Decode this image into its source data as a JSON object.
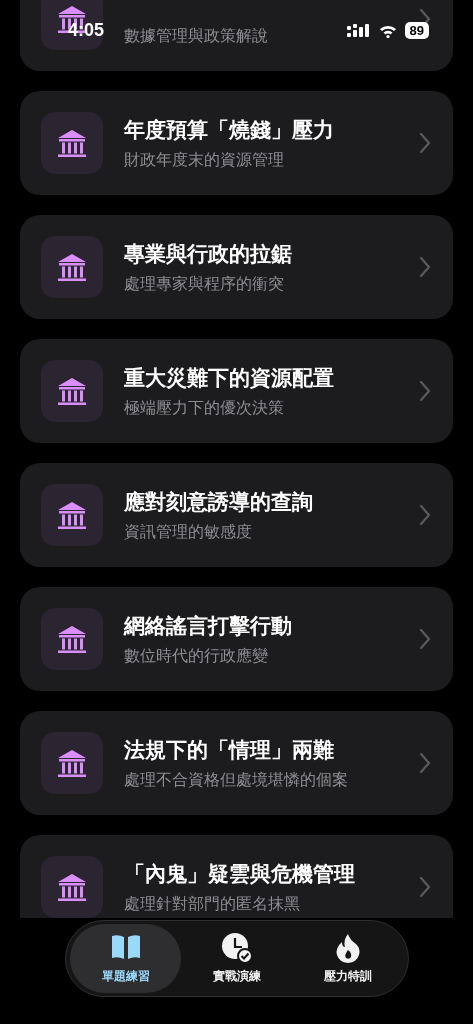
{
  "status_bar": {
    "time": "4:05",
    "battery": "89"
  },
  "lessons": [
    {
      "subtitle": "數據管理與政策解說"
    },
    {
      "title": "年度預算「燒錢」壓力",
      "subtitle": "財政年度末的資源管理"
    },
    {
      "title": "專業與行政的拉鋸",
      "subtitle": "處理專家與程序的衝突"
    },
    {
      "title": "重大災難下的資源配置",
      "subtitle": "極端壓力下的優次決策"
    },
    {
      "title": "應對刻意誘導的查詢",
      "subtitle": "資訊管理的敏感度"
    },
    {
      "title": "網絡謠言打擊行動",
      "subtitle": "數位時代的行政應變"
    },
    {
      "title": "法規下的「情理」兩難",
      "subtitle": "處理不合資格但處境堪憐的個案"
    },
    {
      "title": "「內鬼」疑雲與危機管理",
      "subtitle": "處理針對部門的匿名抹黑"
    }
  ],
  "tab_bar": [
    {
      "label": "單題練習",
      "kind": "book",
      "selected": true
    },
    {
      "label": "實戰演練",
      "kind": "clock",
      "selected": false
    },
    {
      "label": "壓力特訓",
      "kind": "flame",
      "selected": false
    }
  ]
}
